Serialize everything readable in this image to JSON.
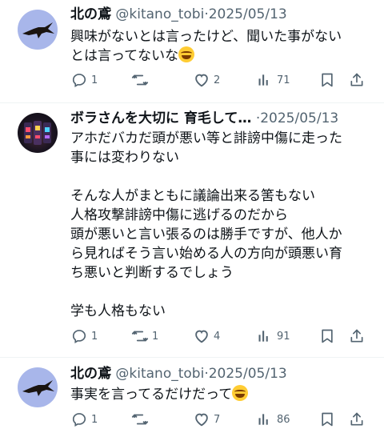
{
  "tweets": [
    {
      "name": "北の鳶",
      "handle": "@kitano_tobi",
      "sep": "·",
      "date": "2025/05/13",
      "lines": [
        "興味がないとは言ったけど、聞いた事がない",
        "とは言ってないな"
      ],
      "emoji": "laughing-tears-emoji",
      "avatar": "kite-bird",
      "reply_count": "1",
      "retweet_count": "",
      "like_count": "2",
      "views_count": "71"
    },
    {
      "name": "ボラさんを大切に 育毛して…",
      "handle": "",
      "sep": "·",
      "date": "2025/05/13",
      "text": "アホだバカだ頭が悪い等と誹謗中傷に走った\n事には変わりない\n\nそんな人がまともに議論出来る筈もない\n人格攻撃誹謗中傷に逃げるのだから\n頭が悪いと言い張るのは勝手ですが、他人か\nら見ればそう言い始める人の方向が頭悪い育\nち悪いと判断するでしょう\n\n学も人格もない",
      "avatar": "slot-machine",
      "reply_count": "1",
      "retweet_count": "1",
      "like_count": "4",
      "views_count": "91"
    },
    {
      "name": "北の鳶",
      "handle": "@kitano_tobi",
      "sep": "·",
      "date": "2025/05/13",
      "lines": [
        "事実を言ってるだけだって"
      ],
      "emoji": "laughing-tears-emoji",
      "avatar": "kite-bird",
      "reply_count": "1",
      "retweet_count": "",
      "like_count": "7",
      "views_count": "86"
    }
  ],
  "icons": {
    "reply": "reply-bubble",
    "retweet": "retweet-arrows",
    "like": "heart",
    "views": "bar-chart",
    "bookmark": "bookmark",
    "share": "share-upload"
  },
  "colors": {
    "text": "#0f1419",
    "muted": "#536471",
    "avatar_sky": "#a8b6ea"
  }
}
